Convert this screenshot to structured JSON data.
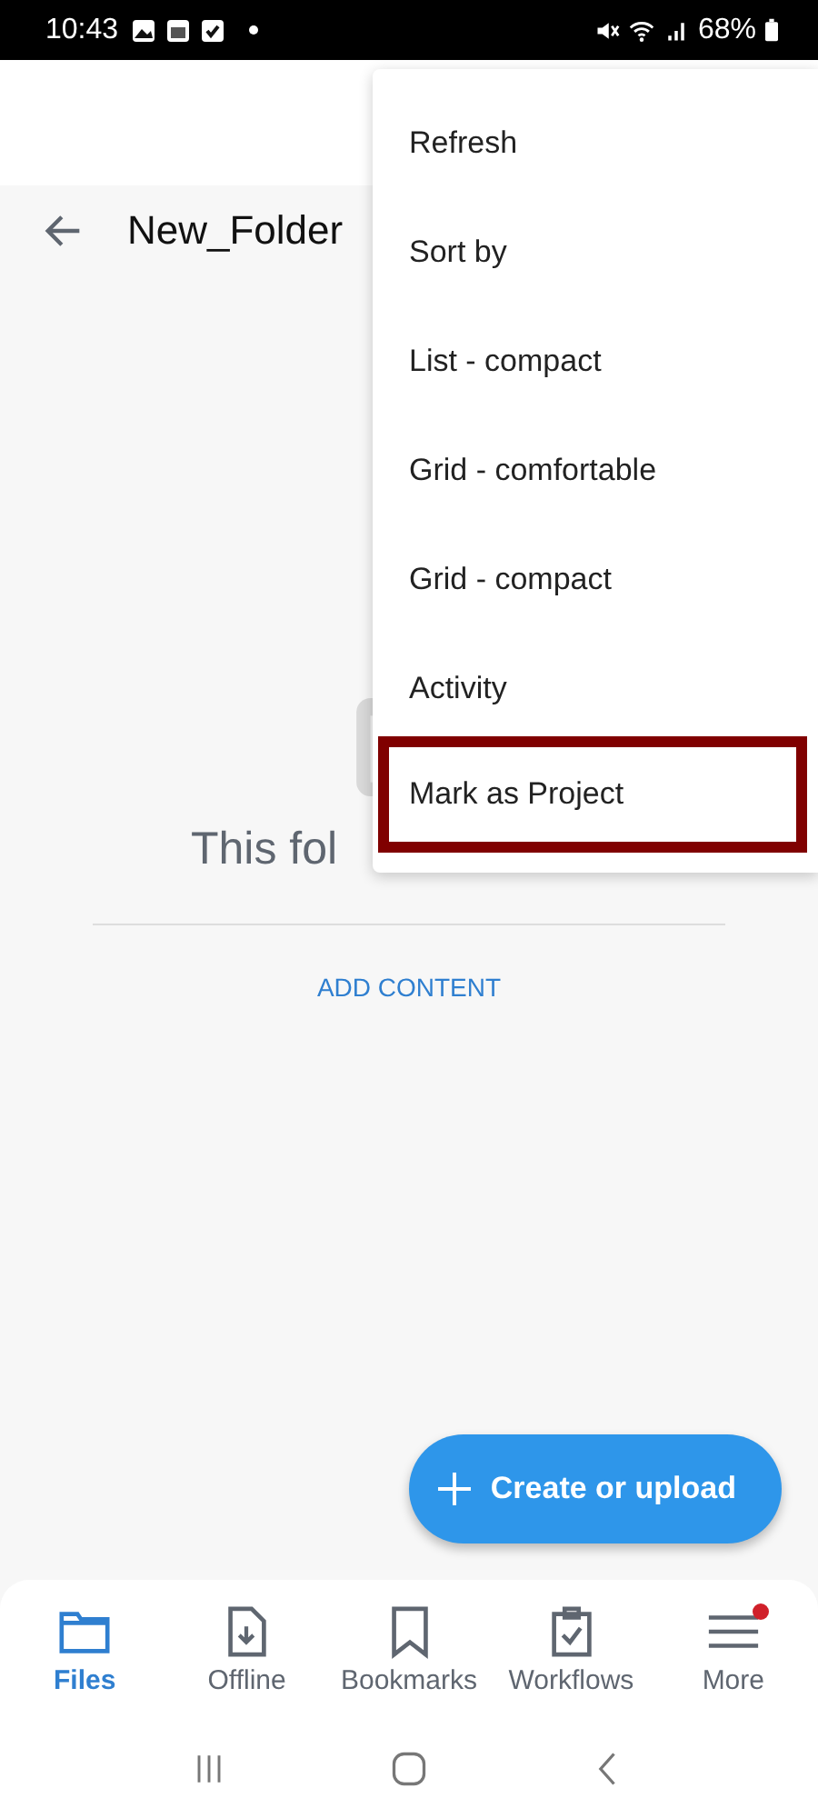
{
  "status_bar": {
    "time": "10:43",
    "battery": "68%"
  },
  "header": {
    "title": "New_Folder"
  },
  "empty_state": {
    "message": "This fol",
    "action": "ADD CONTENT"
  },
  "fab": {
    "label": "Create or upload"
  },
  "menu": {
    "items": [
      {
        "label": "Refresh",
        "highlighted": false
      },
      {
        "label": "Sort by",
        "highlighted": false
      },
      {
        "label": "List - compact",
        "highlighted": false
      },
      {
        "label": "Grid - comfortable",
        "highlighted": false
      },
      {
        "label": "Grid - compact",
        "highlighted": false
      },
      {
        "label": "Activity",
        "highlighted": false
      },
      {
        "label": "Mark as Project",
        "highlighted": true
      }
    ]
  },
  "bottom_nav": [
    {
      "label": "Files",
      "kind": "folder",
      "selected": true,
      "badge": false
    },
    {
      "label": "Offline",
      "kind": "download",
      "selected": false,
      "badge": false
    },
    {
      "label": "Bookmarks",
      "kind": "bookmark",
      "selected": false,
      "badge": false
    },
    {
      "label": "Workflows",
      "kind": "clipboard",
      "selected": false,
      "badge": false
    },
    {
      "label": "More",
      "kind": "menu",
      "selected": false,
      "badge": true
    }
  ]
}
